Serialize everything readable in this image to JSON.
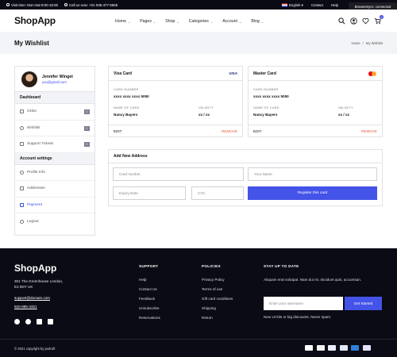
{
  "topbar": {
    "visit": "Visit time: Mon-Sat 8:00-18:00",
    "call": "Call us now: +01 035-477-5568",
    "language": "English",
    "contact": "Contact",
    "help": "Help"
  },
  "tooltip": "Browsersync: connected",
  "header": {
    "logo": "ShopApp",
    "nav": [
      "Home",
      "Pages",
      "Shop",
      "Categories",
      "Account",
      "Blog"
    ],
    "cart_count": "0"
  },
  "band": {
    "title": "My Wishlist",
    "breadcrumb_home": "Home",
    "breadcrumb_sep": "/",
    "breadcrumb_current": "My Wishlist"
  },
  "sidebar": {
    "name": "Jennifer Winget",
    "email": "you@gmail.com",
    "dashboard_label": "Dashboard",
    "order_label": "Order",
    "order_count": "0",
    "wishlist_label": "Wishlist",
    "wishlist_count": "0",
    "tickets_label": "Support Tickets",
    "tickets_count": "0",
    "account_label": "Account settings",
    "profile_label": "Profile Info",
    "addresses_label": "Addresses",
    "payment_label": "Payment",
    "logout_label": "Logout"
  },
  "visa_card": {
    "title": "Visa Card",
    "brand": "VISA",
    "number_label": "CARD NUMBER",
    "number": "xxxx xxxx xxxx 5050",
    "name_label": "NAME OF CARD",
    "name": "Nancy Bayers",
    "validity_label": "VALIDITY",
    "validity": "xx / xx",
    "edit": "EDIT",
    "remove": "REMOVE"
  },
  "master_card": {
    "title": "Master Card",
    "number_label": "CARD NUMBER",
    "number": "xxxx xxxx xxxx 5050",
    "name_label": "NAME OF CARD",
    "name": "Nancy Bayers",
    "validity_label": "VALIDITY",
    "validity": "xx / xx",
    "edit": "EDIT",
    "remove": "REMOVE"
  },
  "address_form": {
    "title": "Add New Address",
    "card_number_ph": "Card number",
    "your_name_ph": "Your Name",
    "expiry_ph": "Expiry Date",
    "cvc_ph": "CVC",
    "register": "Register this card"
  },
  "footer": {
    "logo": "ShopApp",
    "address_line1": "301 The Greenhouse London,",
    "address_line2": "E2 8DY UK",
    "email": "support@domain.com",
    "phone": "820-885-3321",
    "support_title": "SUPPORT",
    "support_links": [
      "Help",
      "Contact Us",
      "Feedback",
      "Unsubscribe",
      "Reservations"
    ],
    "policies_title": "POLICIES",
    "policies_links": [
      "Privacy Policy",
      "Terms of use",
      "Gift card conditions",
      "Shipping",
      "Return"
    ],
    "stay_title": "STAY UP TO DATE",
    "stay_text": "Aliquam erat volutpat. Nam dui mi, tincidunt quis, accumsan.",
    "subscribe_ph": "Enter your username",
    "get_started": "Get Started",
    "spam_note": "New UI kits or big discounts. Never spam.",
    "copyright": "© 2021 copyright by pxdraft"
  },
  "colors": {
    "accent": "#4453e8",
    "remove": "#e8593a",
    "dark": "#0a0b14"
  }
}
